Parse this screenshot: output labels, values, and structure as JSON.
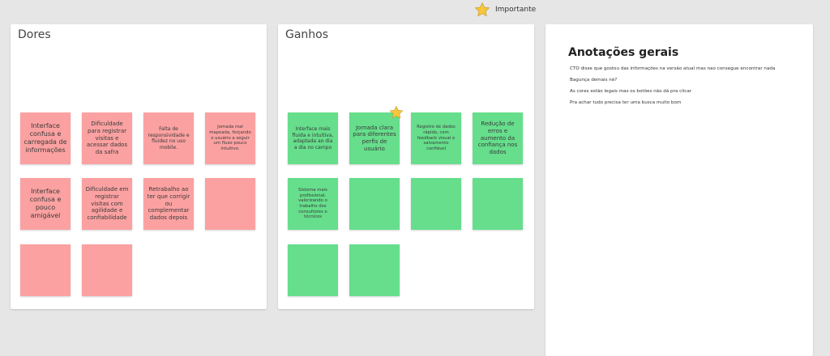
{
  "legend": {
    "icon": "star-icon",
    "label": "Importante"
  },
  "colors": {
    "pink": "#fca1a1",
    "green": "#66de8c",
    "star": "#f6c73a"
  },
  "dores": {
    "title": "Dores",
    "notes": [
      "Interface confusa e carregada de informações",
      "Dificuldade para registrar visitas e acessar dados da safra",
      "Falta de responsividade e fluidez no uso mobile.",
      "Jornada mal mapeada, forçando o usuário a seguir um fluxo pouco intuitivo.",
      "Interface confusa e pouco amigável",
      "Dificuldade em registrar visitas com agilidade e confiabilidade",
      "Retrabalho ao ter que corrigir ou complementar dados depois",
      "",
      "",
      ""
    ]
  },
  "ganhos": {
    "title": "Ganhos",
    "notes": [
      "Interface mais fluida e intuitiva, adaptada ao dia a dia no campo",
      "Jornada clara para diferentes perfis de usuário",
      "Registro de dados rápido, com feedback visual e salvamento confiável",
      "Redução de erros e aumento da confiança nos dados",
      "Sistema mais profissional, valorizando o trabalho dos consultores e técnicos",
      "",
      "",
      "",
      "",
      ""
    ]
  },
  "notes_panel": {
    "heading": "Anotações gerais",
    "items": [
      "CTO disse que gostou das informações na versão atual mas nao consegue encontrar nada",
      "Bagunça demais né?",
      "As cores estão legais mas os botões não dá pra clicar",
      "Pra achar tudo precisa ter uma busca muito bom"
    ]
  }
}
